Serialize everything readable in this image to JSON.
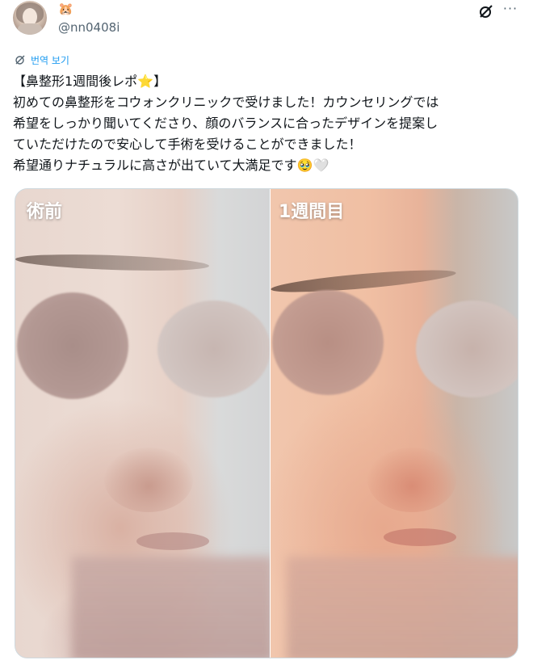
{
  "user": {
    "display_name_emoji": "🐹",
    "handle": "@nn0408i"
  },
  "actions": {
    "grok_icon": "grok-icon",
    "more_label": "···"
  },
  "translate": {
    "label": "번역 보기"
  },
  "tweet": {
    "line1": "【鼻整形1週間後レポ",
    "line1_emoji": "⭐",
    "line1_end": "】",
    "line2": "初めての鼻整形をコウォンクリニックで受けました！カウンセリングでは",
    "line3": "希望をしっかり聞いてくださり、顔のバランスに合ったデザインを提案し",
    "line4": "ていただけたので安心して手術を受けることができました！",
    "line5": "希望通りナチュラルに高さが出ていて大満足です",
    "line5_emoji1": "🥹",
    "line5_emoji2": "🤍"
  },
  "media": {
    "before_label": "術前",
    "after_label": "1週間目"
  },
  "colors": {
    "link": "#1d9bf0",
    "secondary_text": "#536471"
  }
}
